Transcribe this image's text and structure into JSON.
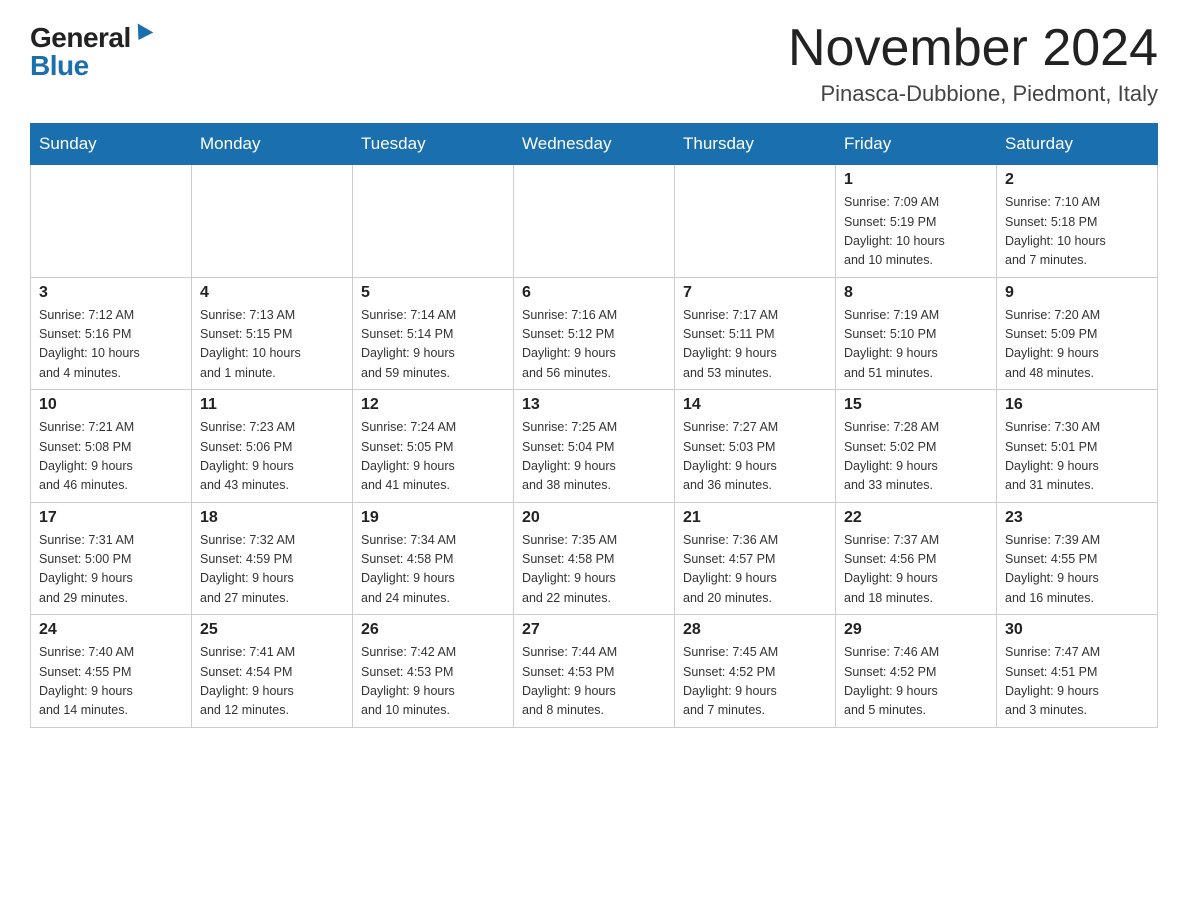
{
  "header": {
    "logo_general": "General",
    "logo_blue": "Blue",
    "month_year": "November 2024",
    "location": "Pinasca-Dubbione, Piedmont, Italy"
  },
  "weekdays": [
    "Sunday",
    "Monday",
    "Tuesday",
    "Wednesday",
    "Thursday",
    "Friday",
    "Saturday"
  ],
  "weeks": [
    [
      {
        "day": "",
        "info": ""
      },
      {
        "day": "",
        "info": ""
      },
      {
        "day": "",
        "info": ""
      },
      {
        "day": "",
        "info": ""
      },
      {
        "day": "",
        "info": ""
      },
      {
        "day": "1",
        "info": "Sunrise: 7:09 AM\nSunset: 5:19 PM\nDaylight: 10 hours\nand 10 minutes."
      },
      {
        "day": "2",
        "info": "Sunrise: 7:10 AM\nSunset: 5:18 PM\nDaylight: 10 hours\nand 7 minutes."
      }
    ],
    [
      {
        "day": "3",
        "info": "Sunrise: 7:12 AM\nSunset: 5:16 PM\nDaylight: 10 hours\nand 4 minutes."
      },
      {
        "day": "4",
        "info": "Sunrise: 7:13 AM\nSunset: 5:15 PM\nDaylight: 10 hours\nand 1 minute."
      },
      {
        "day": "5",
        "info": "Sunrise: 7:14 AM\nSunset: 5:14 PM\nDaylight: 9 hours\nand 59 minutes."
      },
      {
        "day": "6",
        "info": "Sunrise: 7:16 AM\nSunset: 5:12 PM\nDaylight: 9 hours\nand 56 minutes."
      },
      {
        "day": "7",
        "info": "Sunrise: 7:17 AM\nSunset: 5:11 PM\nDaylight: 9 hours\nand 53 minutes."
      },
      {
        "day": "8",
        "info": "Sunrise: 7:19 AM\nSunset: 5:10 PM\nDaylight: 9 hours\nand 51 minutes."
      },
      {
        "day": "9",
        "info": "Sunrise: 7:20 AM\nSunset: 5:09 PM\nDaylight: 9 hours\nand 48 minutes."
      }
    ],
    [
      {
        "day": "10",
        "info": "Sunrise: 7:21 AM\nSunset: 5:08 PM\nDaylight: 9 hours\nand 46 minutes."
      },
      {
        "day": "11",
        "info": "Sunrise: 7:23 AM\nSunset: 5:06 PM\nDaylight: 9 hours\nand 43 minutes."
      },
      {
        "day": "12",
        "info": "Sunrise: 7:24 AM\nSunset: 5:05 PM\nDaylight: 9 hours\nand 41 minutes."
      },
      {
        "day": "13",
        "info": "Sunrise: 7:25 AM\nSunset: 5:04 PM\nDaylight: 9 hours\nand 38 minutes."
      },
      {
        "day": "14",
        "info": "Sunrise: 7:27 AM\nSunset: 5:03 PM\nDaylight: 9 hours\nand 36 minutes."
      },
      {
        "day": "15",
        "info": "Sunrise: 7:28 AM\nSunset: 5:02 PM\nDaylight: 9 hours\nand 33 minutes."
      },
      {
        "day": "16",
        "info": "Sunrise: 7:30 AM\nSunset: 5:01 PM\nDaylight: 9 hours\nand 31 minutes."
      }
    ],
    [
      {
        "day": "17",
        "info": "Sunrise: 7:31 AM\nSunset: 5:00 PM\nDaylight: 9 hours\nand 29 minutes."
      },
      {
        "day": "18",
        "info": "Sunrise: 7:32 AM\nSunset: 4:59 PM\nDaylight: 9 hours\nand 27 minutes."
      },
      {
        "day": "19",
        "info": "Sunrise: 7:34 AM\nSunset: 4:58 PM\nDaylight: 9 hours\nand 24 minutes."
      },
      {
        "day": "20",
        "info": "Sunrise: 7:35 AM\nSunset: 4:58 PM\nDaylight: 9 hours\nand 22 minutes."
      },
      {
        "day": "21",
        "info": "Sunrise: 7:36 AM\nSunset: 4:57 PM\nDaylight: 9 hours\nand 20 minutes."
      },
      {
        "day": "22",
        "info": "Sunrise: 7:37 AM\nSunset: 4:56 PM\nDaylight: 9 hours\nand 18 minutes."
      },
      {
        "day": "23",
        "info": "Sunrise: 7:39 AM\nSunset: 4:55 PM\nDaylight: 9 hours\nand 16 minutes."
      }
    ],
    [
      {
        "day": "24",
        "info": "Sunrise: 7:40 AM\nSunset: 4:55 PM\nDaylight: 9 hours\nand 14 minutes."
      },
      {
        "day": "25",
        "info": "Sunrise: 7:41 AM\nSunset: 4:54 PM\nDaylight: 9 hours\nand 12 minutes."
      },
      {
        "day": "26",
        "info": "Sunrise: 7:42 AM\nSunset: 4:53 PM\nDaylight: 9 hours\nand 10 minutes."
      },
      {
        "day": "27",
        "info": "Sunrise: 7:44 AM\nSunset: 4:53 PM\nDaylight: 9 hours\nand 8 minutes."
      },
      {
        "day": "28",
        "info": "Sunrise: 7:45 AM\nSunset: 4:52 PM\nDaylight: 9 hours\nand 7 minutes."
      },
      {
        "day": "29",
        "info": "Sunrise: 7:46 AM\nSunset: 4:52 PM\nDaylight: 9 hours\nand 5 minutes."
      },
      {
        "day": "30",
        "info": "Sunrise: 7:47 AM\nSunset: 4:51 PM\nDaylight: 9 hours\nand 3 minutes."
      }
    ]
  ]
}
